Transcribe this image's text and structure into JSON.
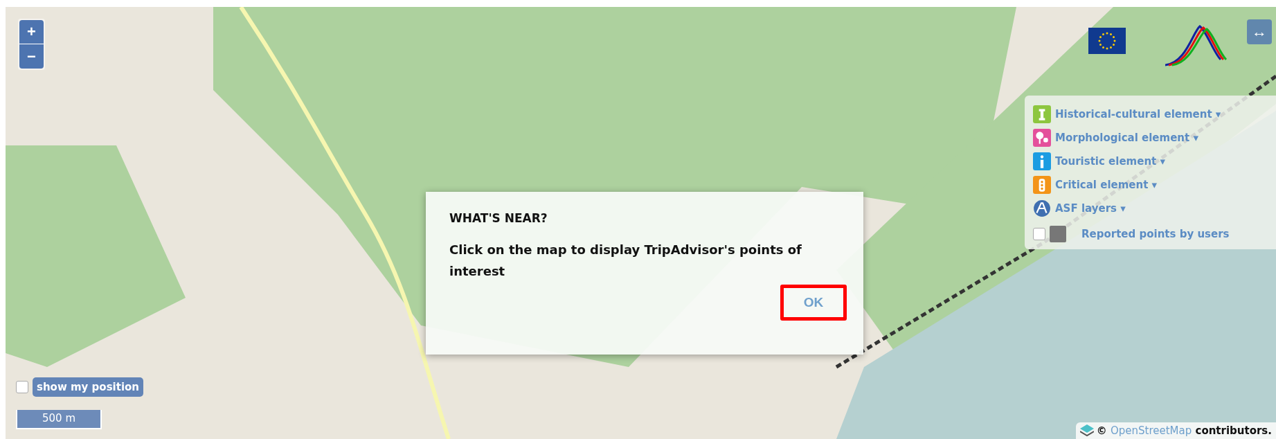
{
  "map": {
    "zoom_controls": [
      "+",
      "−"
    ],
    "expand_label": "↔",
    "legend": {
      "items": [
        {
          "kind": "tower",
          "label": "Historical-cultural element ▾",
          "color": "#8dc63f"
        },
        {
          "kind": "trees",
          "label": "Morphological element ▾",
          "color": "#e4509b"
        },
        {
          "kind": "info",
          "label": "Touristic element ▾",
          "color": "#1b9ce2"
        },
        {
          "kind": "signal",
          "label": "Critical element ▾",
          "color": "#f39419"
        },
        {
          "kind": "asf",
          "label": "ASF layers ▾",
          "color": "#3f6fb0"
        }
      ],
      "reported": {
        "label": "Reported points by users",
        "checked": false
      }
    },
    "dialog": {
      "title": "WHAT'S NEAR?",
      "message": "Click on the map to display TripAdvisor's points of interest",
      "ok": "OK"
    },
    "position": {
      "label": "show my position",
      "checked": false
    },
    "scale": "500 m",
    "attribution": {
      "symbol": "©",
      "link": "OpenStreetMap",
      "rest": "contributors."
    }
  }
}
